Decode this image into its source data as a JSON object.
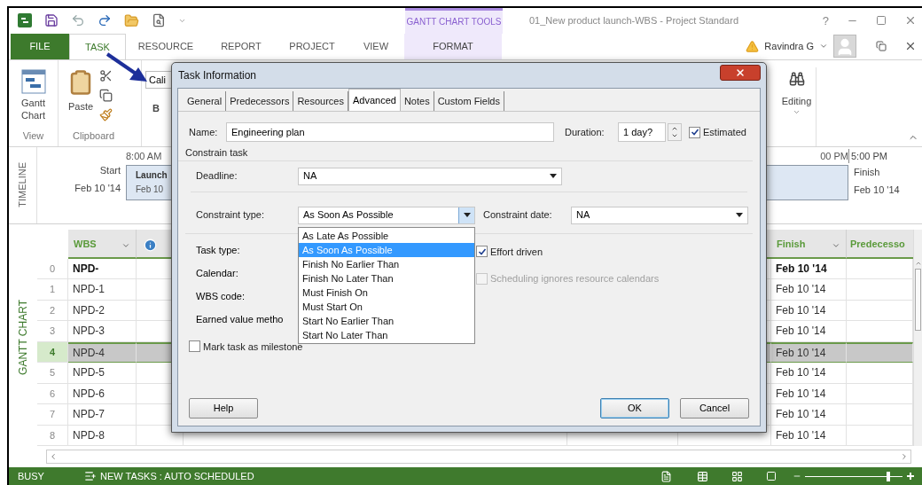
{
  "title_bar": {
    "contextual_group": "GANTT CHART TOOLS",
    "title": "01_New product launch-WBS - Project Standard",
    "help": "?"
  },
  "ribbon_tabs": [
    {
      "label": "FILE",
      "kind": "file",
      "selected": false
    },
    {
      "label": "TASK",
      "kind": "tab",
      "selected": true
    },
    {
      "label": "RESOURCE",
      "kind": "tab",
      "selected": false
    },
    {
      "label": "REPORT",
      "kind": "tab",
      "selected": false
    },
    {
      "label": "PROJECT",
      "kind": "tab",
      "selected": false
    },
    {
      "label": "VIEW",
      "kind": "tab",
      "selected": false
    },
    {
      "label": "FORMAT",
      "kind": "contextual",
      "selected": false
    }
  ],
  "user": {
    "name": "Ravindra G"
  },
  "ribbon": {
    "gantt_button": "Gantt Chart",
    "view_group": "View",
    "paste_button": "Paste",
    "clipboard_group": "Clipboard",
    "font_box": "Cali",
    "bold_button": "B",
    "editing_button": "Editing"
  },
  "timeline": {
    "label": "TIMELINE",
    "start_label": "Start",
    "start_date": "Feb 10 '14",
    "start_time": "8:00 AM",
    "bar_task": "Launch",
    "bar_date": "Feb 10",
    "mid_time": "00 PM",
    "end_time": "5:00 PM",
    "finish_label": "Finish",
    "finish_date": "Feb 10 '14"
  },
  "grid": {
    "side_label": "GANTT CHART",
    "wbs_header": "WBS",
    "finish_header": "Finish",
    "predecessors_header": "Predecesso",
    "rows": [
      {
        "number": "0",
        "wbs": "NPD-",
        "finish": "Feb 10 '14",
        "summary": true,
        "selected": false
      },
      {
        "number": "1",
        "wbs": "NPD-1",
        "finish": "Feb 10 '14",
        "summary": false,
        "selected": false
      },
      {
        "number": "2",
        "wbs": "NPD-2",
        "finish": "Feb 10 '14",
        "summary": false,
        "selected": false
      },
      {
        "number": "3",
        "wbs": "NPD-3",
        "finish": "Feb 10 '14",
        "summary": false,
        "selected": false
      },
      {
        "number": "4",
        "wbs": "NPD-4",
        "finish": "Feb 10 '14",
        "summary": false,
        "selected": true
      },
      {
        "number": "5",
        "wbs": "NPD-5",
        "finish": "Feb 10 '14",
        "summary": false,
        "selected": false
      },
      {
        "number": "6",
        "wbs": "NPD-6",
        "finish": "Feb 10 '14",
        "summary": false,
        "selected": false
      },
      {
        "number": "7",
        "wbs": "NPD-7",
        "finish": "Feb 10 '14",
        "summary": false,
        "selected": false
      },
      {
        "number": "8",
        "wbs": "NPD-8",
        "finish": "Feb 10 '14",
        "summary": false,
        "selected": false
      }
    ]
  },
  "status_bar": {
    "mode": "BUSY",
    "new_tasks": "NEW TASKS : AUTO SCHEDULED",
    "zoom": {
      "level": 0.85
    }
  },
  "dialog": {
    "title": "Task Information",
    "tabs": [
      {
        "label": "General",
        "selected": false
      },
      {
        "label": "Predecessors",
        "selected": false
      },
      {
        "label": "Resources",
        "selected": false
      },
      {
        "label": "Advanced",
        "selected": true
      },
      {
        "label": "Notes",
        "selected": false
      },
      {
        "label": "Custom Fields",
        "selected": false
      }
    ],
    "name": {
      "label": "Name:",
      "value": "Engineering plan"
    },
    "duration": {
      "label": "Duration:",
      "value": "1 day?"
    },
    "estimated": {
      "label": "Estimated",
      "checked": true
    },
    "section": "Constrain task",
    "deadline": {
      "label": "Deadline:",
      "value": "NA"
    },
    "constraint_type": {
      "label": "Constraint type:",
      "value": "As Soon As Possible",
      "options": [
        {
          "label": "As Late As Possible",
          "selected": false
        },
        {
          "label": "As Soon As Possible",
          "selected": true
        },
        {
          "label": "Finish No Earlier Than",
          "selected": false
        },
        {
          "label": "Finish No Later Than",
          "selected": false
        },
        {
          "label": "Must Finish On",
          "selected": false
        },
        {
          "label": "Must Start On",
          "selected": false
        },
        {
          "label": "Start No Earlier Than",
          "selected": false
        },
        {
          "label": "Start No Later Than",
          "selected": false
        }
      ]
    },
    "constraint_date": {
      "label": "Constraint date:",
      "value": "NA"
    },
    "task_type": "Task type:",
    "calendar": "Calendar:",
    "wbs_code": "WBS code:",
    "earned_value": "Earned value metho",
    "effort_driven": {
      "label": "Effort driven",
      "checked": true,
      "disabled": false
    },
    "scheduling_ignores": {
      "label": "Scheduling ignores resource calendars",
      "checked": false,
      "disabled": true
    },
    "milestone": {
      "label": "Mark task as milestone",
      "checked": false
    },
    "buttons": [
      {
        "label": "Help",
        "default": false
      },
      {
        "label": "OK",
        "default": true
      },
      {
        "label": "Cancel",
        "default": false
      }
    ]
  }
}
